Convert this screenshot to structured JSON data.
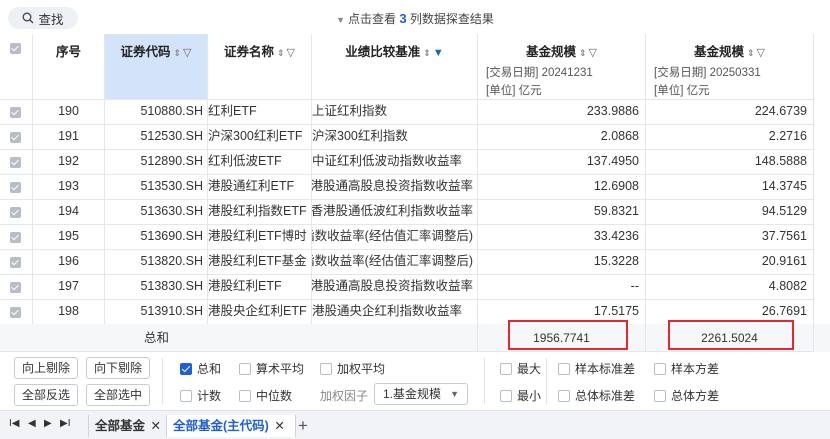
{
  "toolbar": {
    "search_label": "查找",
    "notice_prefix": "点击查看",
    "notice_count": "3",
    "notice_suffix": "列数据探查结果"
  },
  "table": {
    "headers": {
      "seq": "序号",
      "code": "证券代码",
      "name": "证券名称",
      "benchmark": "业绩比较基准",
      "scale1": "基金规模",
      "scale1_sub1": "[交易日期] 20241231",
      "scale1_sub2": "[单位] 亿元",
      "scale2": "基金规模",
      "scale2_sub1": "[交易日期] 20250331",
      "scale2_sub2": "[单位] 亿元"
    },
    "rows": [
      {
        "seq": "190",
        "code": "510880.SH",
        "name": "红利ETF",
        "bench": "上证红利指数",
        "v1": "233.9886",
        "v2": "224.6739"
      },
      {
        "seq": "191",
        "code": "512530.SH",
        "name": "沪深300红利ETF",
        "bench": "沪深300红利指数",
        "v1": "2.0868",
        "v2": "2.2716"
      },
      {
        "seq": "192",
        "code": "512890.SH",
        "name": "红利低波ETF",
        "bench": "中证红利低波动指数收益率",
        "v1": "137.4950",
        "v2": "148.5888"
      },
      {
        "seq": "193",
        "code": "513530.SH",
        "name": "港股通红利ETF",
        "bench": "港股通高股息投资指数收益率",
        "v1": "12.6908",
        "v2": "14.3745"
      },
      {
        "seq": "194",
        "code": "513630.SH",
        "name": "港股红利指数ETF",
        "bench": "香港股通低波红利指数收益率",
        "v1": "59.8321",
        "v2": "94.5129"
      },
      {
        "seq": "195",
        "code": "513690.SH",
        "name": "港股红利ETF博时",
        "bench": "指数收益率(经估值汇率调整后)",
        "v1": "33.4236",
        "v2": "37.7561"
      },
      {
        "seq": "196",
        "code": "513820.SH",
        "name": "港股红利ETF基金",
        "bench": "指数收益率(经估值汇率调整后)",
        "v1": "15.3228",
        "v2": "20.9161"
      },
      {
        "seq": "197",
        "code": "513830.SH",
        "name": "港股红利ETF",
        "bench": "港股通高股息投资指数收益率",
        "v1": "--",
        "v2": "4.8082"
      },
      {
        "seq": "198",
        "code": "513910.SH",
        "name": "港股央企红利ETF",
        "bench": "港股通央企红利指数收益率",
        "v1": "17.5175",
        "v2": "26.7691"
      }
    ],
    "summary_label": "总和",
    "summary_v1": "1956.7741",
    "summary_v2": "2261.5024"
  },
  "controls": {
    "btn_delete_up": "向上剔除",
    "btn_delete_down": "向下剔除",
    "btn_invert": "全部反选",
    "btn_select_all": "全部选中",
    "opt_sum": "总和",
    "opt_mean": "算术平均",
    "opt_weighted": "加权平均",
    "opt_count": "计数",
    "opt_median": "中位数",
    "weight_label": "加权因子",
    "weight_value": "1.基金规模",
    "opt_max": "最大",
    "opt_min": "最小",
    "opt_sample_std": "样本标准差",
    "opt_pop_std": "总体标准差",
    "opt_sample_var": "样本方差",
    "opt_pop_var": "总体方差"
  },
  "tabs": {
    "tab1": "全部基金",
    "tab2": "全部基金(主代码)",
    "add": "+"
  },
  "colors": {
    "accent": "#1f5fd6",
    "highlight": "#e8262e",
    "selected_col": "#d3e3fa"
  }
}
